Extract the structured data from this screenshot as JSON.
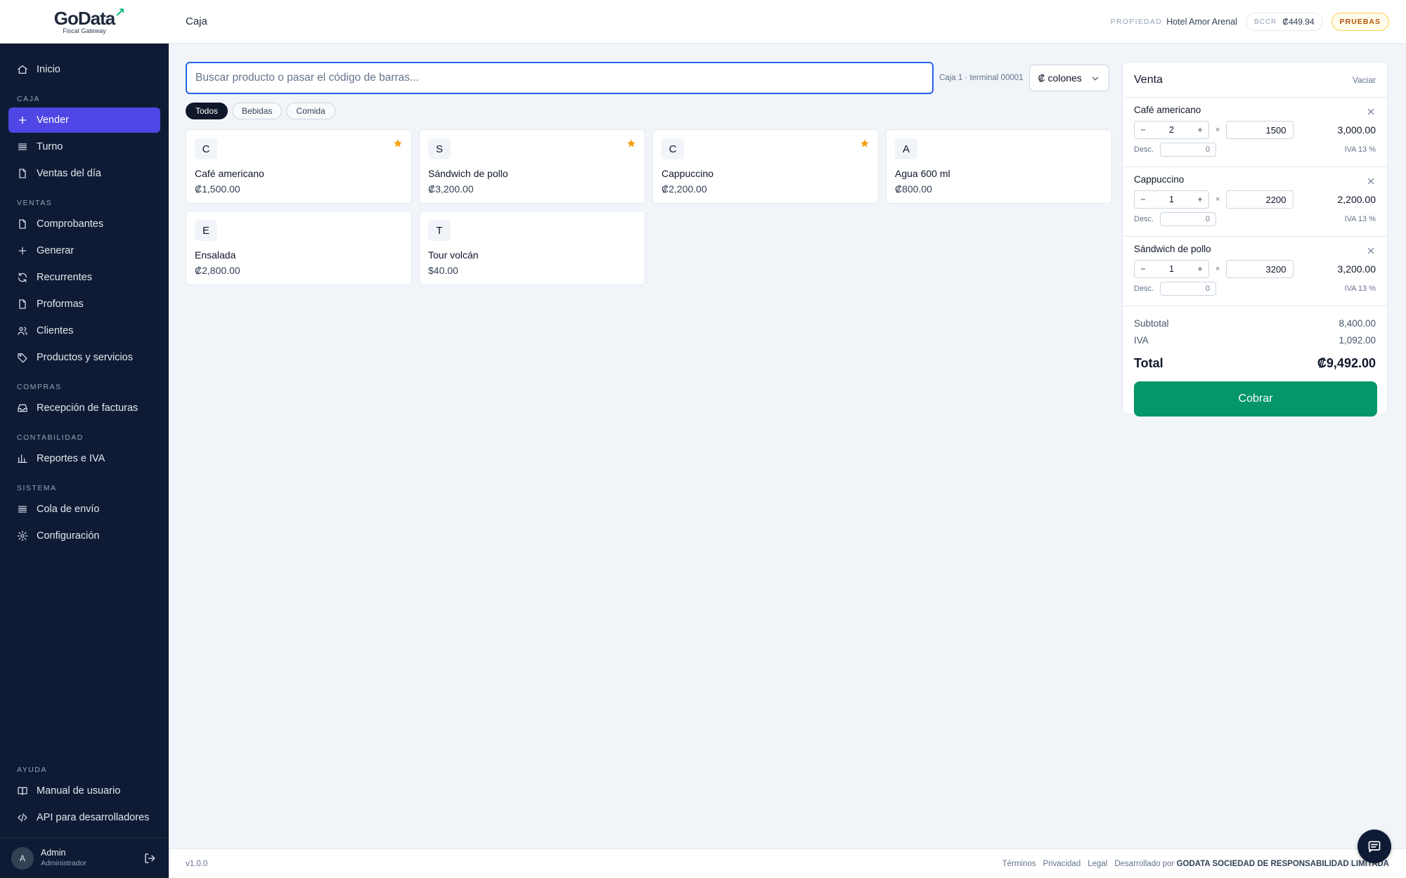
{
  "brand": {
    "name": "GoData",
    "tagline": "Fiscal Gateway",
    "accent": "#10b981"
  },
  "header": {
    "title": "Caja",
    "property_label": "PROPIEDAD",
    "property_name": "Hotel Amor Arenal",
    "rate_label": "BCCR",
    "rate_value": "₡449.94",
    "env_badge": "PRUEBAS"
  },
  "sidebar": {
    "items": [
      {
        "label": "Inicio",
        "icon": "home-icon"
      }
    ],
    "sections": [
      {
        "label": "CAJA",
        "items": [
          {
            "label": "Vender",
            "icon": "plus-icon",
            "active": true
          },
          {
            "label": "Turno",
            "icon": "layers-icon"
          },
          {
            "label": "Ventas del día",
            "icon": "document-icon"
          }
        ]
      },
      {
        "label": "VENTAS",
        "items": [
          {
            "label": "Comprobantes",
            "icon": "document-icon"
          },
          {
            "label": "Generar",
            "icon": "plus-icon"
          },
          {
            "label": "Recurrentes",
            "icon": "refresh-icon"
          },
          {
            "label": "Proformas",
            "icon": "document-icon"
          },
          {
            "label": "Clientes",
            "icon": "users-icon"
          },
          {
            "label": "Productos y servicios",
            "icon": "tag-icon"
          }
        ]
      },
      {
        "label": "COMPRAS",
        "items": [
          {
            "label": "Recepción de facturas",
            "icon": "inbox-icon"
          }
        ]
      },
      {
        "label": "CONTABILIDAD",
        "items": [
          {
            "label": "Reportes e IVA",
            "icon": "bar-chart-icon"
          }
        ]
      },
      {
        "label": "SISTEMA",
        "items": [
          {
            "label": "Cola de envío",
            "icon": "layers-icon"
          },
          {
            "label": "Configuración",
            "icon": "gear-icon"
          }
        ]
      }
    ],
    "help": {
      "label": "AYUDA",
      "items": [
        {
          "label": "Manual de usuario",
          "icon": "book-icon"
        },
        {
          "label": "API para desarrolladores",
          "icon": "code-icon"
        }
      ]
    },
    "user": {
      "initial": "A",
      "name": "Admin",
      "role": "Administrador"
    }
  },
  "search": {
    "placeholder": "Buscar producto o pasar el código de barras...",
    "value": ""
  },
  "terminal": "Caja 1 · terminal 00001",
  "currency": "₡ colones",
  "filters": [
    {
      "label": "Todos",
      "active": true
    },
    {
      "label": "Bebidas"
    },
    {
      "label": "Comida"
    }
  ],
  "products": [
    {
      "initial": "C",
      "name": "Café americano",
      "price": "₡1,500.00",
      "favorite": true
    },
    {
      "initial": "S",
      "name": "Sándwich de pollo",
      "price": "₡3,200.00",
      "favorite": true
    },
    {
      "initial": "C",
      "name": "Cappuccino",
      "price": "₡2,200.00",
      "favorite": true
    },
    {
      "initial": "A",
      "name": "Agua 600 ml",
      "price": "₡800.00",
      "favorite": false
    },
    {
      "initial": "E",
      "name": "Ensalada",
      "price": "₡2,800.00",
      "favorite": false
    },
    {
      "initial": "T",
      "name": "Tour volcán",
      "price": "$40.00",
      "favorite": false
    }
  ],
  "cart": {
    "title": "Venta",
    "clear_label": "Vaciar",
    "times_symbol": "×",
    "discount_label": "Desc.",
    "lines": [
      {
        "name": "Café americano",
        "qty": "2",
        "price": "1500",
        "total": "3,000.00",
        "discount": "0",
        "tax": "IVA 13 %"
      },
      {
        "name": "Cappuccino",
        "qty": "1",
        "price": "2200",
        "total": "2,200.00",
        "discount": "0",
        "tax": "IVA 13 %"
      },
      {
        "name": "Sándwich de pollo",
        "qty": "1",
        "price": "3200",
        "total": "3,200.00",
        "discount": "0",
        "tax": "IVA 13 %"
      }
    ],
    "subtotal_label": "Subtotal",
    "subtotal": "8,400.00",
    "tax_label": "IVA",
    "tax": "1,092.00",
    "total_label": "Total",
    "total": "₡9,492.00",
    "charge_label": "Cobrar"
  },
  "footer": {
    "version": "v1.0.0",
    "links": [
      "Términos",
      "Privacidad",
      "Legal"
    ],
    "developed_by": "Desarrollado por",
    "company": "GODATA SOCIEDAD DE RESPONSABILIDAD LIMITADA"
  }
}
